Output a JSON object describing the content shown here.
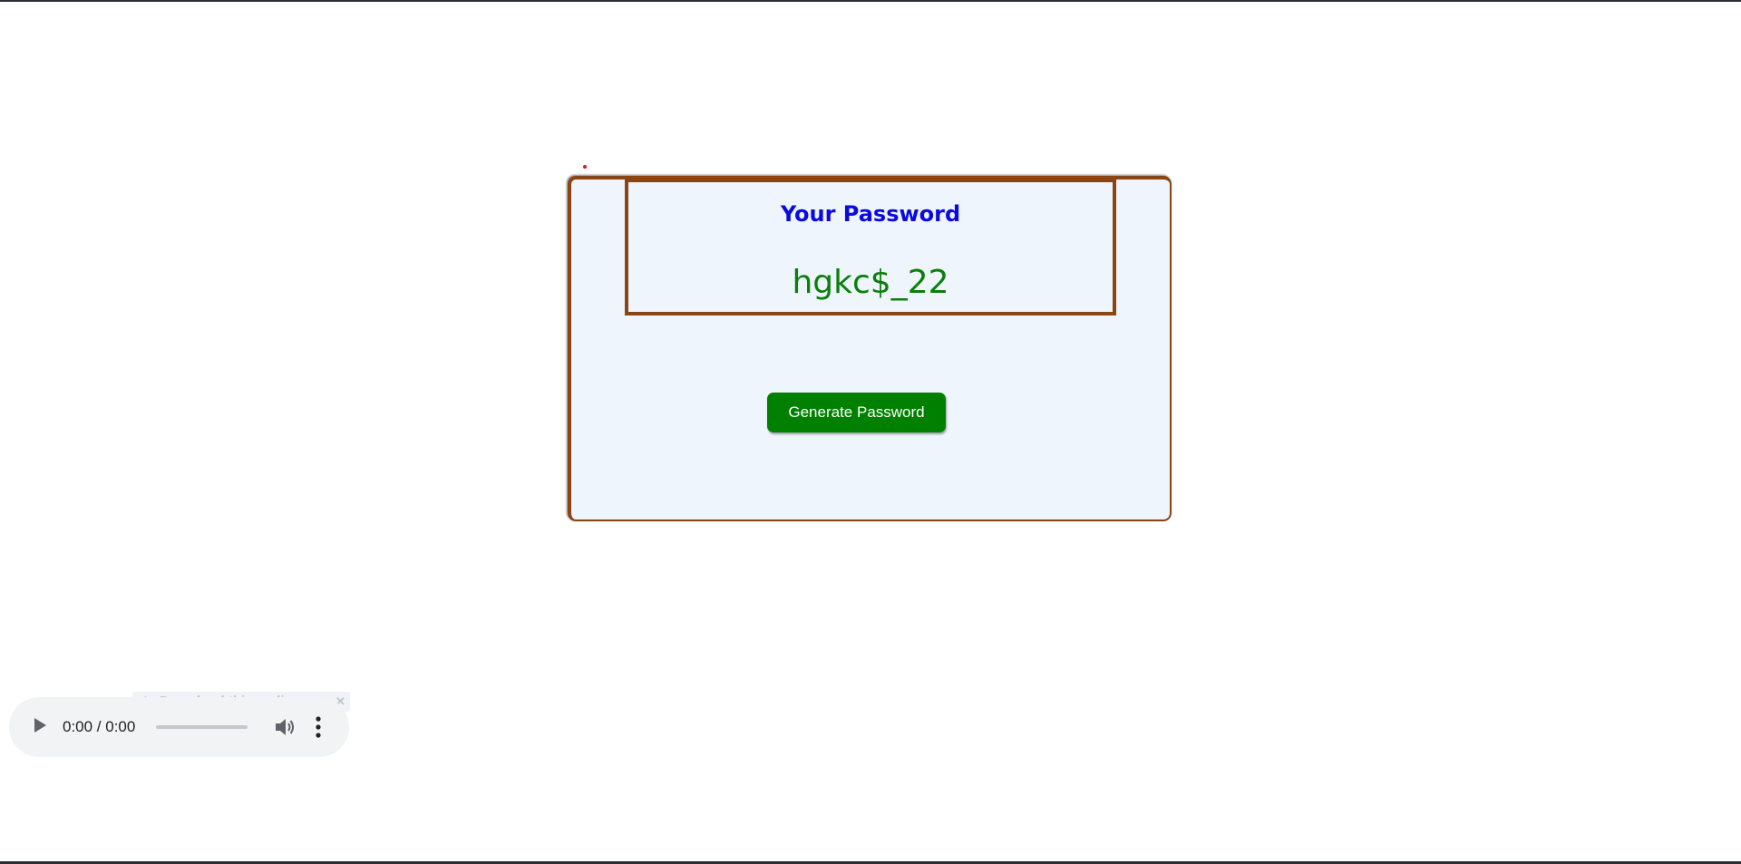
{
  "password_card": {
    "title": "Your Password",
    "password_value": "hgkc$_22"
  },
  "actions": {
    "generate_label": "Generate Password"
  },
  "download_overlay": {
    "play_glyph": "▶",
    "label": "Download this audio",
    "help_glyph": "?",
    "close_glyph": "✕"
  },
  "audio_player": {
    "time_display": "0:00 / 0:00",
    "progress": 0,
    "icons": [
      "play-icon",
      "volume-icon",
      "more-options-icon"
    ]
  },
  "colors": {
    "title": "#0a0ae0",
    "password": "#0a7f0a",
    "button": "#008000",
    "border": "#8b4513",
    "card_background": "#eef5fc"
  }
}
